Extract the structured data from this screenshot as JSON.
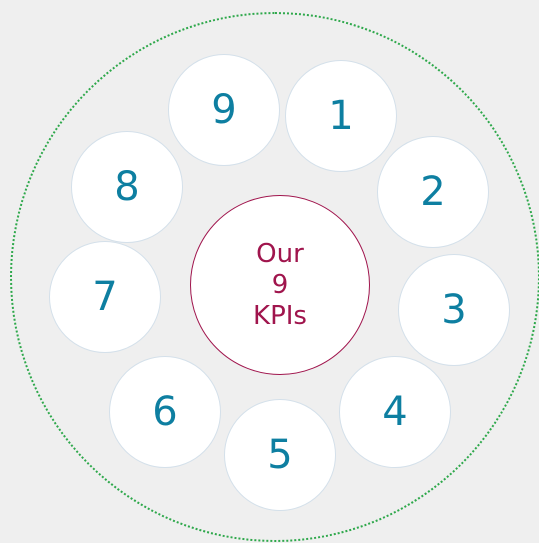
{
  "center": {
    "lines": [
      "Our",
      "9",
      "KPIs"
    ]
  },
  "kpis": [
    {
      "label": "1"
    },
    {
      "label": "2"
    },
    {
      "label": "3"
    },
    {
      "label": "4"
    },
    {
      "label": "5"
    },
    {
      "label": "6"
    },
    {
      "label": "7"
    },
    {
      "label": "8"
    },
    {
      "label": "9"
    }
  ],
  "colors": {
    "background": "#efefef",
    "kpi_text": "#0e7fa1",
    "center_accent": "#a0154d",
    "ring_dots": "#2ea84b"
  }
}
